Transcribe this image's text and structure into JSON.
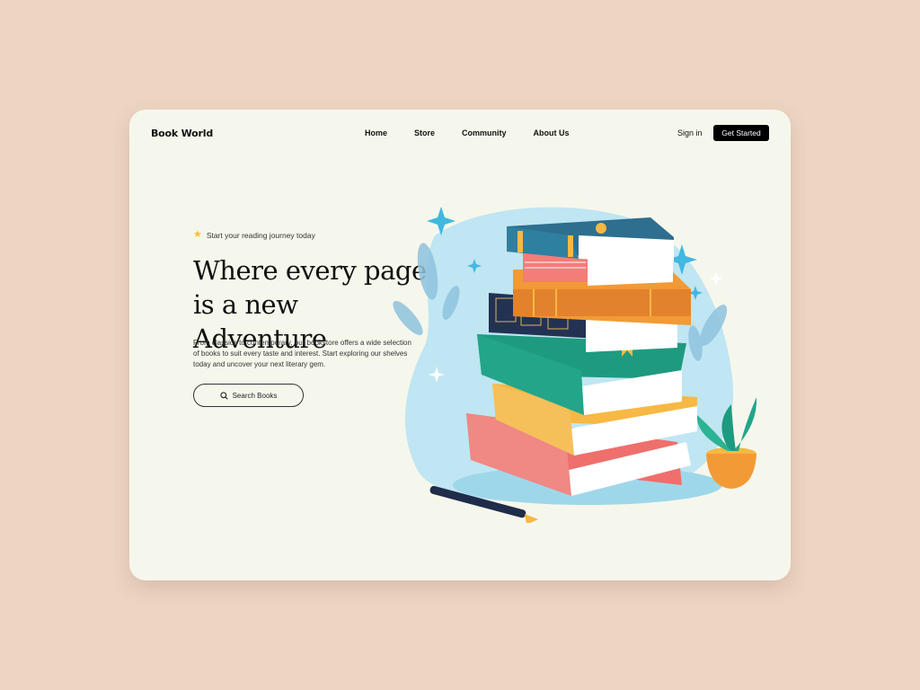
{
  "brand": {
    "name": "Book World"
  },
  "nav": {
    "items": [
      "Home",
      "Store",
      "Community",
      "About Us"
    ],
    "signin_label": "Sign in",
    "cta_label": "Get Started"
  },
  "hero": {
    "tagline": "Start your reading journey today",
    "headline_line1": "Where every page",
    "headline_line2": "is a new Adventure",
    "description": "From classics to contemporary, our bookstore offers a wide selection of books to suit every taste and interest. Start exploring our shelves today and uncover your next literary gem.",
    "search_button_label": "Search Books",
    "icons": {
      "tagline": "star-icon",
      "search": "search-icon"
    }
  },
  "colors": {
    "page_background": "#EDD5C3",
    "card_background": "#F6F7EC",
    "accent_star": "#F6C229",
    "cta_background": "#000000",
    "illustration_blob": "#BFE6F2"
  }
}
